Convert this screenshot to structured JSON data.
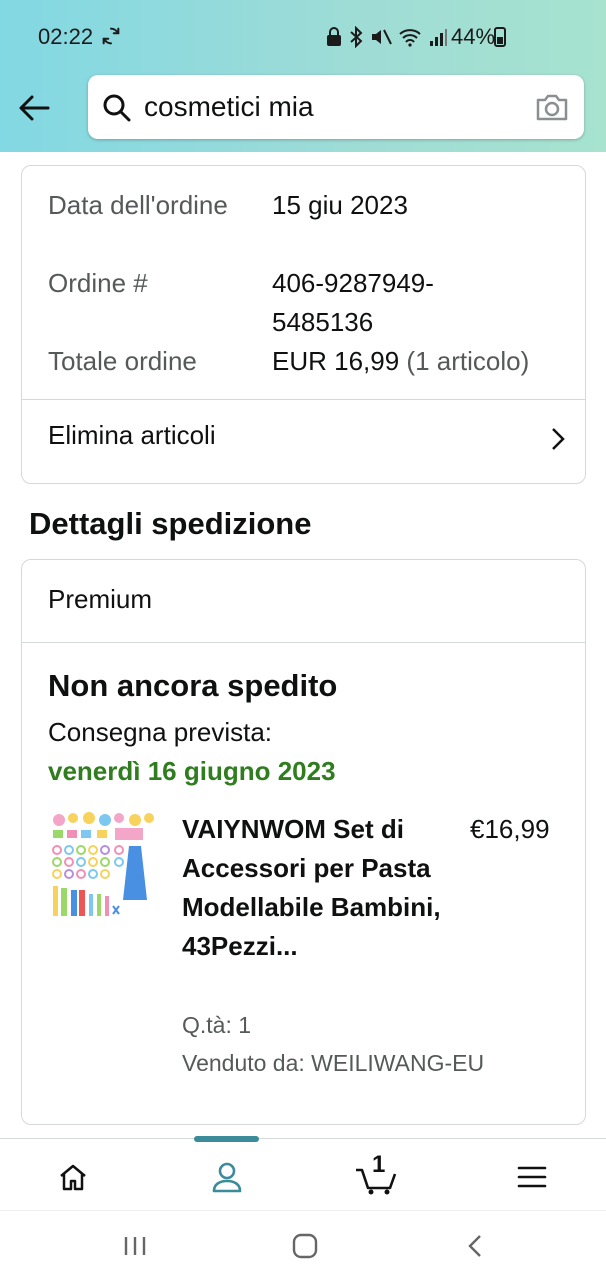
{
  "status_bar": {
    "time": "02:22",
    "battery": "44%"
  },
  "search": {
    "query": "cosmetici mia"
  },
  "order": {
    "date_label": "Data dell'ordine",
    "date_value": "15 giu 2023",
    "number_label": "Ordine #",
    "number_value": "406-9287949-5485136",
    "total_label": "Totale ordine",
    "total_value": "EUR 16,99",
    "total_count": "(1 articolo)",
    "remove_label": "Elimina articoli"
  },
  "shipment": {
    "section_title": "Dettagli spedizione",
    "tier": "Premium",
    "status": "Non ancora spedito",
    "delivery_label": "Consegna prevista:",
    "delivery_date": "venerdì 16 giugno 2023",
    "item": {
      "title": "VAIYNWOM Set di Accessori per Pasta Modellabile Bambini, 43Pezzi...",
      "price": "€16,99",
      "qty": "Q.tà: 1",
      "seller": "Venduto da: WEILIWANG-EU"
    }
  },
  "bottom_nav": {
    "items": [
      "home-icon",
      "account-icon",
      "cart-icon",
      "menu-icon"
    ],
    "cart_count": "1",
    "active_color": "#3b8b9b"
  },
  "colors": {
    "header_gradient_start": "#82d8e3",
    "header_gradient_end": "#a7e3cf",
    "delivery_green": "#2f7d1e"
  }
}
